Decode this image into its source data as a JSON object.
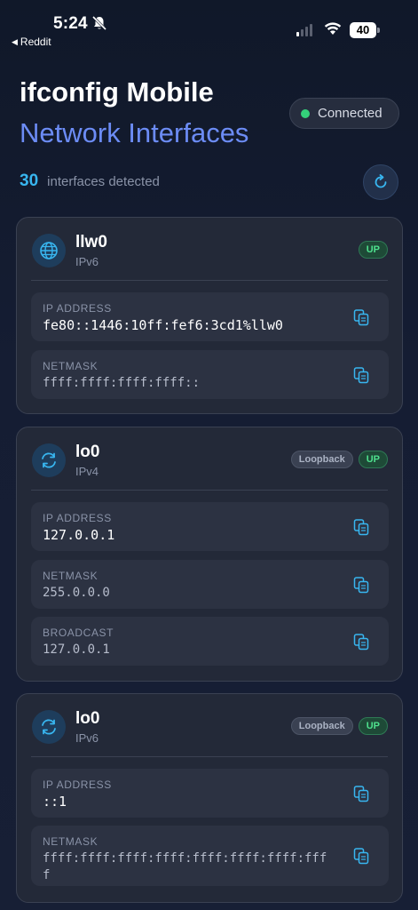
{
  "status_bar": {
    "time": "5:24",
    "back_label": "Reddit",
    "battery": "40"
  },
  "header": {
    "title": "ifconfig Mobile",
    "subtitle": "Network Interfaces",
    "connection_status": "Connected",
    "interface_count": "30",
    "interface_count_label": "interfaces detected"
  },
  "colors": {
    "accent": "#38b6f0",
    "subtitle": "#6c8cf5",
    "connected": "#34d17a",
    "up_badge": "#4ee08d"
  },
  "interfaces": [
    {
      "name": "llw0",
      "family": "IPv6",
      "icon": "globe-icon",
      "badges": {
        "loopback": "",
        "up": "UP"
      },
      "fields": [
        {
          "label": "IP ADDRESS",
          "value": "fe80::1446:10ff:fef6:3cd1%llw0"
        },
        {
          "label": "NETMASK",
          "value": "ffff:ffff:ffff:ffff::"
        }
      ]
    },
    {
      "name": "lo0",
      "family": "IPv4",
      "icon": "loop-icon",
      "badges": {
        "loopback": "Loopback",
        "up": "UP"
      },
      "fields": [
        {
          "label": "IP ADDRESS",
          "value": "127.0.0.1"
        },
        {
          "label": "NETMASK",
          "value": "255.0.0.0"
        },
        {
          "label": "BROADCAST",
          "value": "127.0.0.1"
        }
      ]
    },
    {
      "name": "lo0",
      "family": "IPv6",
      "icon": "loop-icon",
      "badges": {
        "loopback": "Loopback",
        "up": "UP"
      },
      "fields": [
        {
          "label": "IP ADDRESS",
          "value": "::1"
        },
        {
          "label": "NETMASK",
          "value": "ffff:ffff:ffff:ffff:ffff:ffff:ffff:ffff"
        }
      ]
    }
  ]
}
